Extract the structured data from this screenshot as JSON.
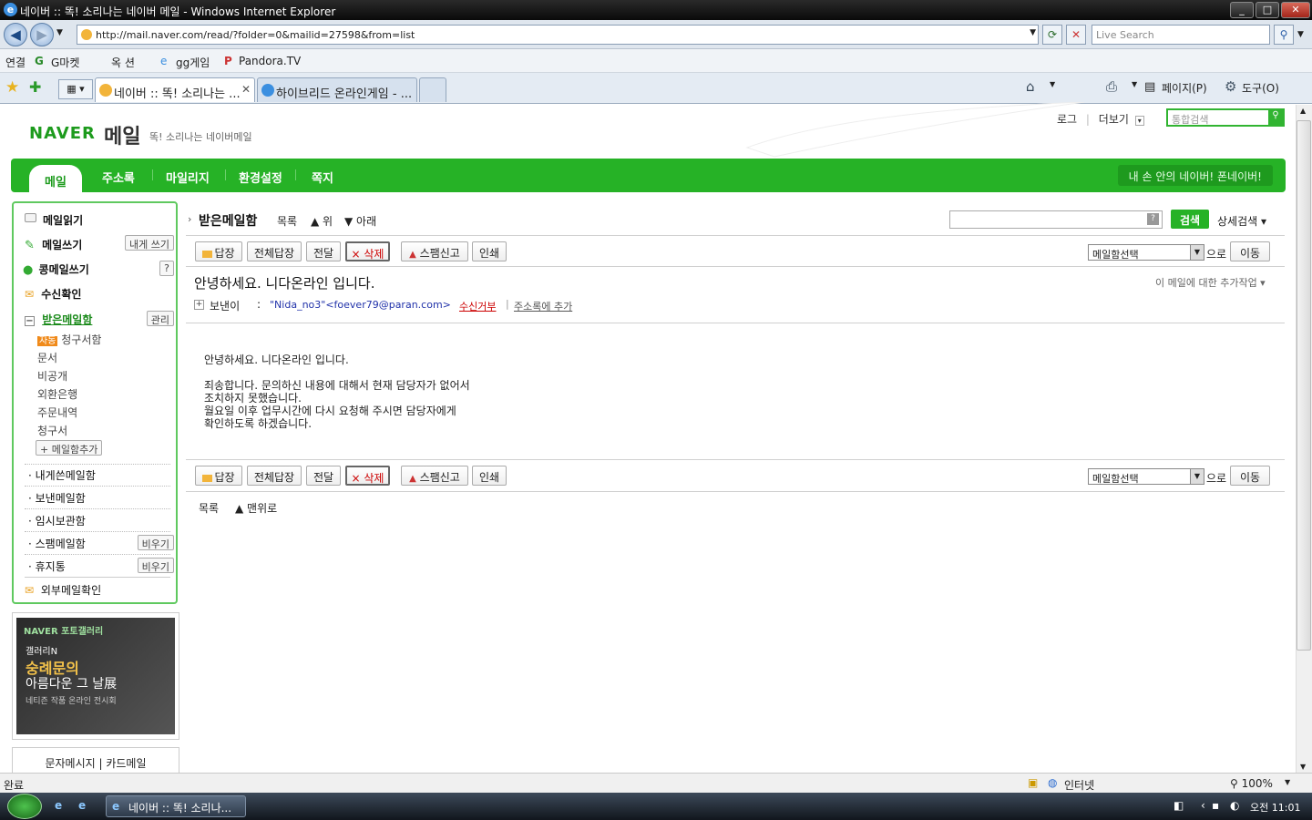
{
  "window": {
    "title": "네이버 :: 똑! 소리나는 네이버 메일 - Windows Internet Explorer",
    "minimize": "_",
    "maximize": "□",
    "close": "✕"
  },
  "browser": {
    "back": "◀",
    "forward": "▶",
    "url": "http://mail.naver.com/read/?folder=0&mailid=27598&from=list",
    "live_search_placeholder": "Live Search",
    "links": [
      "연결",
      "G마켓",
      "옥  션",
      "gg게임",
      "Pandora.TV"
    ],
    "tabs": [
      {
        "label": "네이버 :: 똑! 소리나는 ...",
        "active": true
      },
      {
        "label": "하이브리드 온라인게임 - ...",
        "active": false
      }
    ],
    "command_bar": {
      "page": "페이지(P)",
      "tools": "도구(O)"
    }
  },
  "naver": {
    "logo": "NAVER",
    "service": "메일",
    "tagline": "똑! 소리나는 네이버메일",
    "top_links": [
      "로그",
      "더보기"
    ],
    "search_placeholder": "통합검색",
    "nav": {
      "active": "메일",
      "items": [
        "주소록",
        "마일리지",
        "환경설정",
        "쪽지"
      ],
      "promo": "내 손 안의 네이버! 폰네이버!"
    }
  },
  "sidebar": {
    "read_mail": "메일읽기",
    "write_mail": "메일쓰기",
    "write_self": "내게 쓰기",
    "bean_mail": "콩메일쓰기",
    "bean_help": "?",
    "receipt": "수신확인",
    "inbox": "받은메일함",
    "inbox_manage": "관리",
    "auto_badge": "자동",
    "subfolders": [
      "청구서함",
      "문서",
      "비공개",
      "외환은행",
      "주문내역",
      "청구서"
    ],
    "add_folder": "+ 메일함추가",
    "folders": [
      {
        "label": "내게쓴메일함",
        "action": ""
      },
      {
        "label": "보낸메일함",
        "action": ""
      },
      {
        "label": "임시보관함",
        "action": ""
      },
      {
        "label": "스팸메일함",
        "action": "비우기"
      },
      {
        "label": "휴지통",
        "action": "비우기"
      }
    ],
    "external": "외부메일확인",
    "gallery": {
      "brand": "NAVER 포토갤러리",
      "line1": "갤러리N",
      "line2": "숭례문의",
      "line3": "아름다운 그 날展",
      "line4": "네티즌 작품 온라인 전시회"
    },
    "bottom_links": "문자메시지 | 카드메일"
  },
  "mail": {
    "folder_title": "받은메일함",
    "list_link": "목록",
    "up": "▲ 위",
    "down": "▼ 아래",
    "search_button": "검색",
    "detail_search": "상세검색 ▾",
    "toolbar": {
      "reply": "답장",
      "reply_all": "전체답장",
      "forward": "전달",
      "delete": "× 삭제",
      "spam": "스팸신고",
      "print": "인쇄",
      "folder_select": "메일함선택",
      "to_label": "으로",
      "move": "이동"
    },
    "subject": "안녕하세요. 니다온라인 입니다.",
    "extra_actions": "이 메일에 대한 추가작업 ▾",
    "sender_label": "보낸이",
    "sender": "\"Nida_no3\"<foever79@paran.com>",
    "block": "수신거부",
    "add_contact": "주소록에 추가",
    "body": [
      "안녕하세요. 니다온라인 입니다.",
      "",
      "죄송합니다. 문의하신 내용에 대해서 현재 담당자가 없어서",
      "조치하지 못했습니다.",
      "월요일 이후 업무시간에 다시 요청해 주시면 담당자에게",
      "확인하도록 하겠습니다."
    ],
    "bottom_list": "목록",
    "to_top": "▲ 맨위로"
  },
  "statusbar": {
    "left": "완료",
    "zone": "인터넷",
    "zoom": "100%"
  },
  "taskbar": {
    "item": "네이버 :: 똑! 소리나...",
    "clock": "오전 11:01"
  },
  "colors": {
    "naver_green": "#26b226",
    "link_red": "#c00",
    "sender_blue": "#2233aa"
  }
}
